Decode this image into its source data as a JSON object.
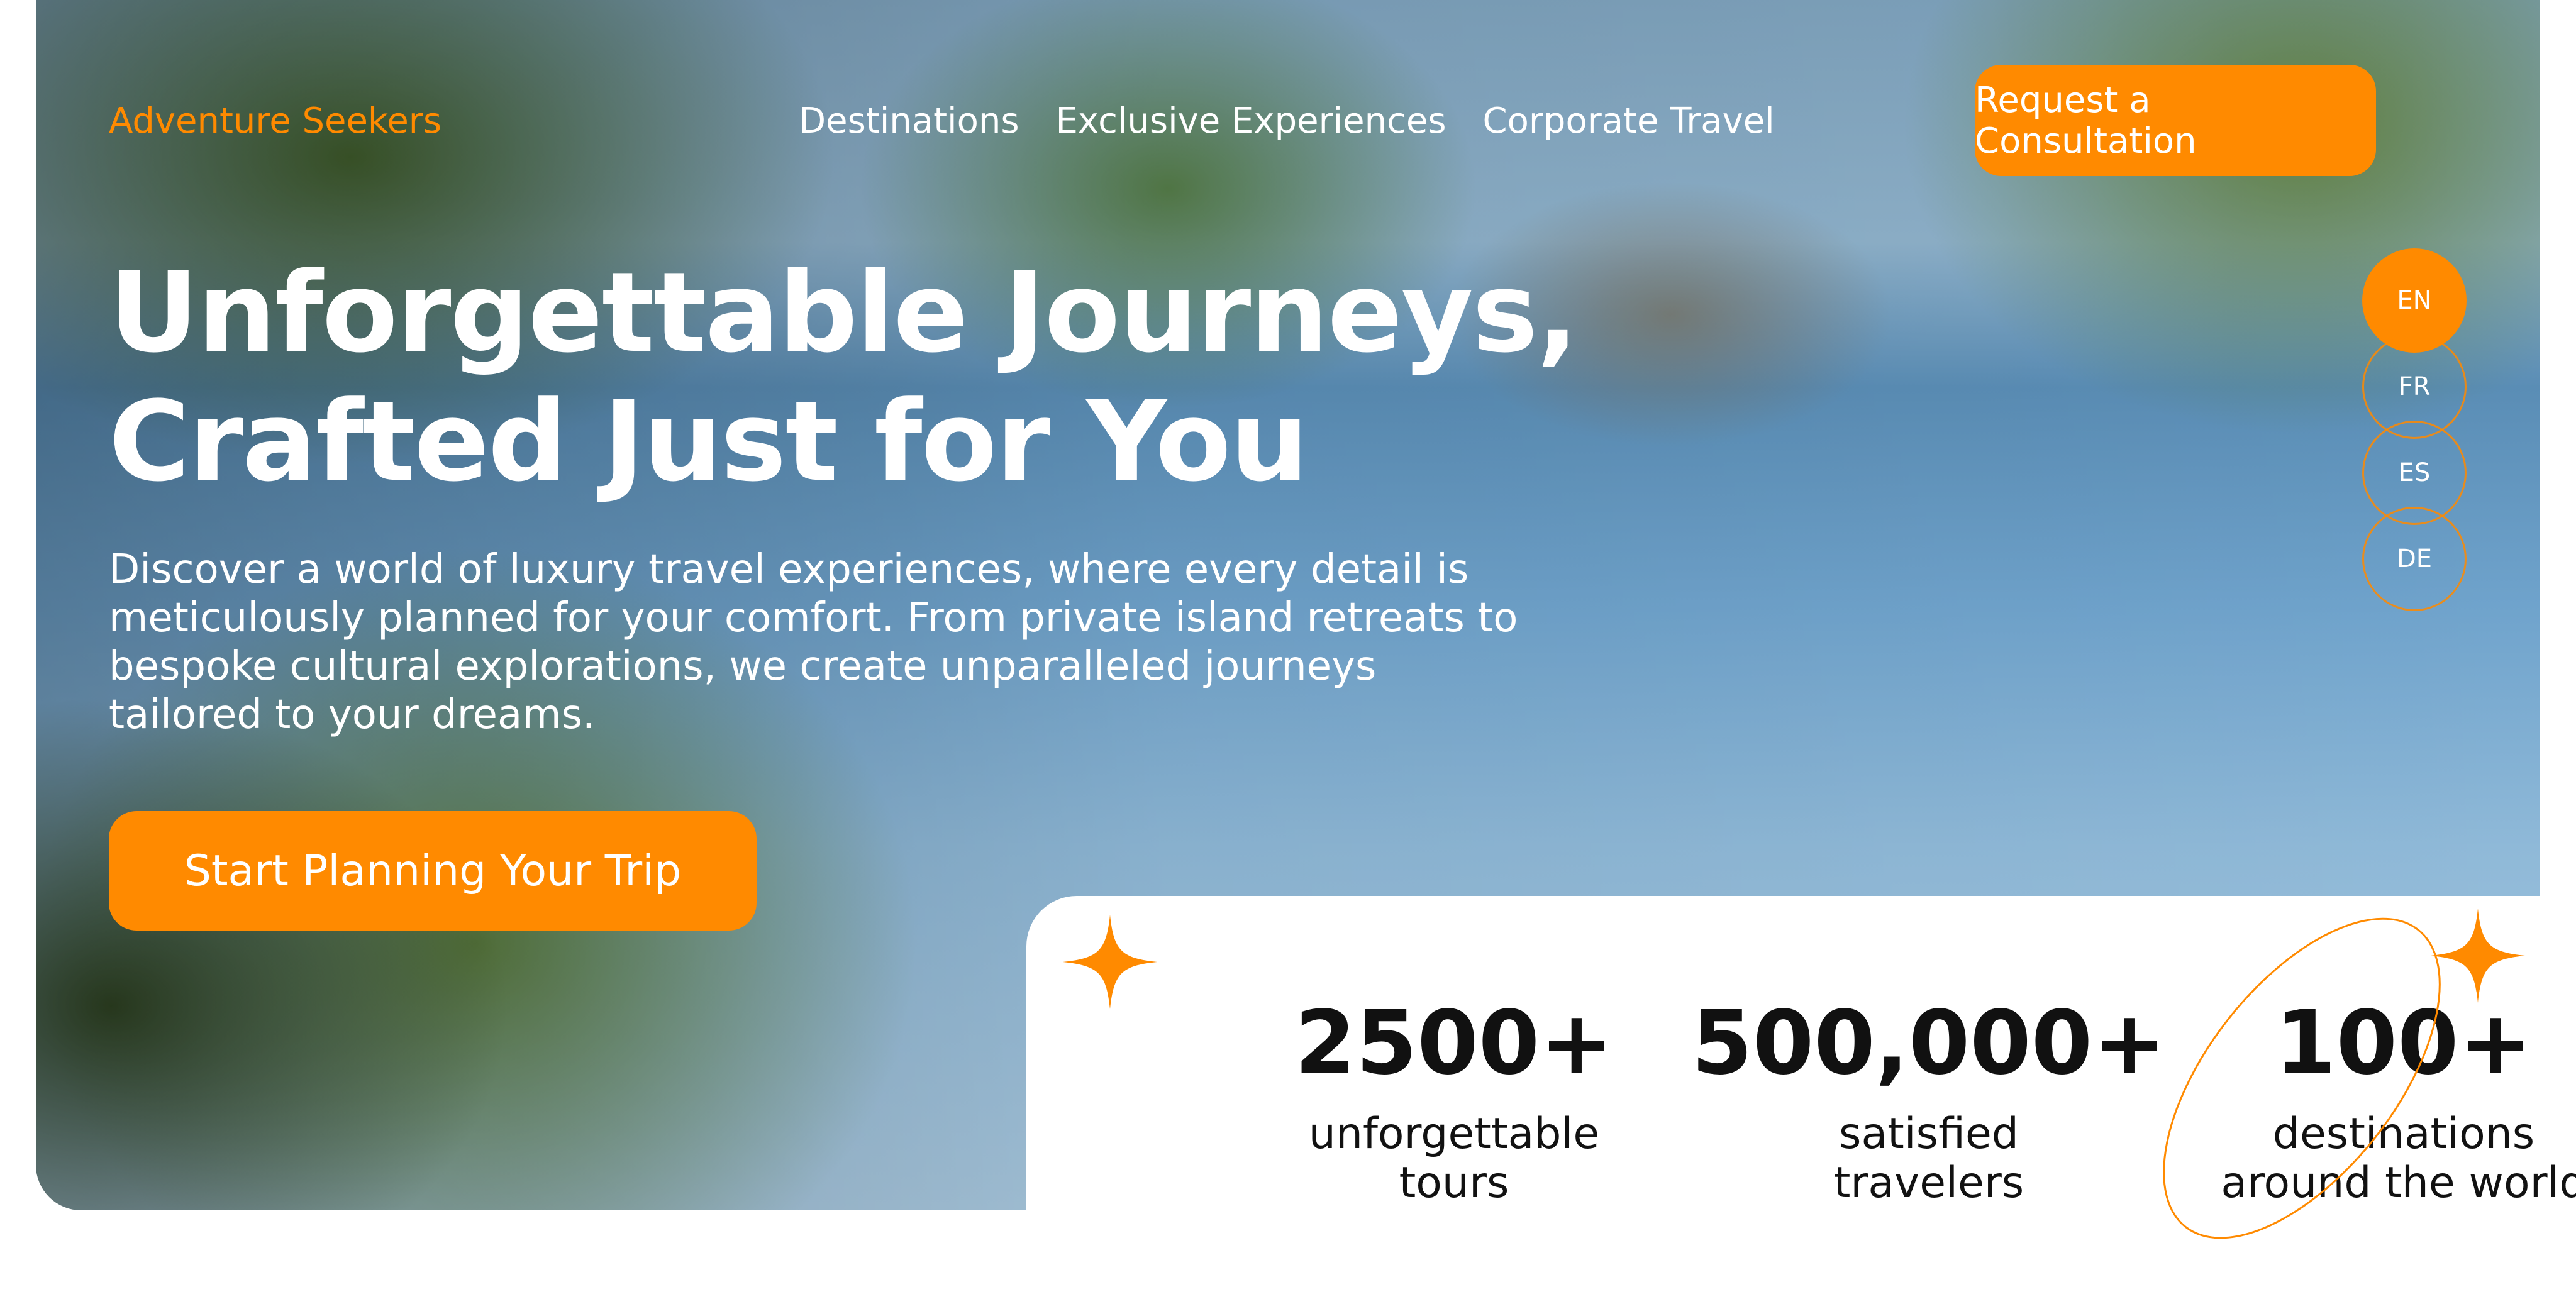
{
  "brand": {
    "name": "Adventure Seekers"
  },
  "nav": {
    "items": [
      {
        "label": "Destinations"
      },
      {
        "label": "Exclusive Experiences"
      },
      {
        "label": "Corporate Travel"
      }
    ],
    "cta_label": "Request a Consultation"
  },
  "languages": {
    "items": [
      {
        "code": "EN",
        "active": true
      },
      {
        "code": "FR",
        "active": false
      },
      {
        "code": "ES",
        "active": false
      },
      {
        "code": "DE",
        "active": false
      }
    ]
  },
  "hero": {
    "headline_line1": "Unforgettable Journeys,",
    "headline_line2": "Crafted Just for You",
    "subtext": "Discover a world of luxury travel experiences, where every detail is meticulously planned for your comfort. From private island retreats to bespoke cultural explorations, we create unparalleled journeys tailored to your dreams.",
    "cta_label": "Start Planning Your Trip"
  },
  "stats": [
    {
      "value": "2500+",
      "label": "unforgettable tours"
    },
    {
      "value": "500,000+",
      "label": "satisfied travelers"
    },
    {
      "value": "100+",
      "label": "destinations around the world"
    }
  ],
  "colors": {
    "accent": "#ff8a00",
    "text_dark": "#111111",
    "text_light": "#ffffff"
  }
}
